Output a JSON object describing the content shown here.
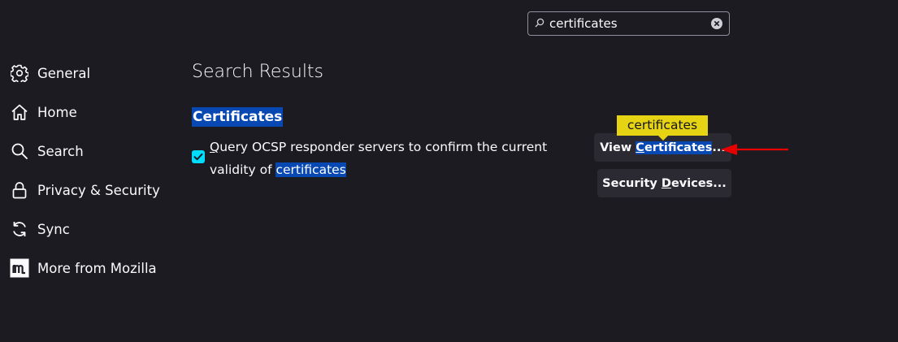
{
  "search": {
    "value": "certificates"
  },
  "sidebar": {
    "items": [
      {
        "label": "General",
        "icon": "gear-icon"
      },
      {
        "label": "Home",
        "icon": "home-icon"
      },
      {
        "label": "Search",
        "icon": "search-icon"
      },
      {
        "label": "Privacy & Security",
        "icon": "lock-icon"
      },
      {
        "label": "Sync",
        "icon": "sync-icon"
      },
      {
        "label": "More from Mozilla",
        "icon": "mozilla-icon"
      }
    ]
  },
  "main": {
    "title": "Search Results",
    "section_heading": "Certificates",
    "ocsp": {
      "access_key": "Q",
      "text_rest": "uery OCSP responder servers to confirm the current validity of ",
      "highlight": "certificates",
      "checked": true
    },
    "buttons": {
      "view_prefix": "View ",
      "view_access": "C",
      "view_rest": "ertificates",
      "view_suffix": "...",
      "security_prefix": "Security ",
      "security_access": "D",
      "security_rest": "evices..."
    },
    "tooltip": "certificates"
  },
  "colors": {
    "background": "#1c1b22",
    "highlight": "#0748b3",
    "checkbox": "#00ddff",
    "tooltip": "#e6d414",
    "annotation_arrow": "#e60000"
  }
}
